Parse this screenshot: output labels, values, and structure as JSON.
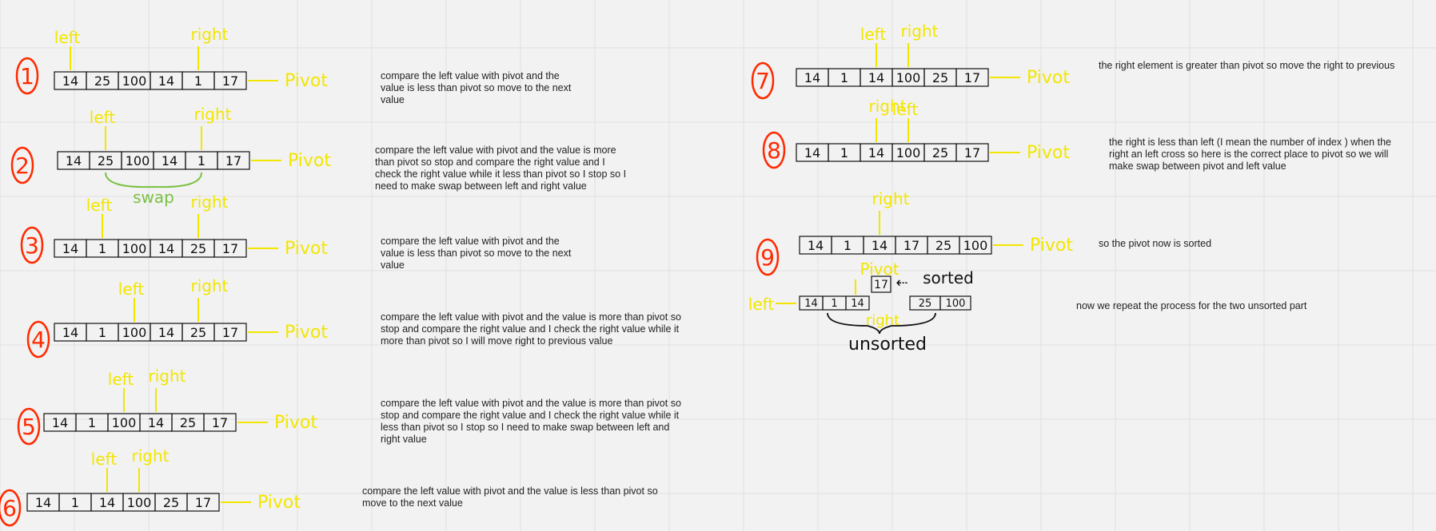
{
  "colors": {
    "marker": "#f2e600",
    "step": "#ff2a00",
    "swap": "#7ac143",
    "ink": "#111111",
    "grid": "#e0e0e0",
    "background": "#f2f2f2"
  },
  "labels": {
    "left": "left",
    "right": "right",
    "pivot": "Pivot",
    "swap": "swap",
    "sorted": "sorted",
    "unsorted": "unsorted"
  },
  "steps": [
    {
      "n": "1",
      "cells": [
        "14",
        "25",
        "100",
        "14",
        "1",
        "17"
      ],
      "left_at": 0,
      "right_at": 4,
      "note": "compare the left value with pivot and the\nvalue is less than pivot so move to the next\nvalue"
    },
    {
      "n": "2",
      "cells": [
        "14",
        "25",
        "100",
        "14",
        "1",
        "17"
      ],
      "left_at": 1,
      "right_at": 4,
      "swap": true,
      "note": "compare the left value with pivot and the value is more\nthan pivot so stop and compare the right value and I\ncheck the right value while it less than pivot so I stop so  I\nneed to make swap between left and right value"
    },
    {
      "n": "3",
      "cells": [
        "14",
        "1",
        "100",
        "14",
        "25",
        "17"
      ],
      "left_at": 1,
      "right_at": 4,
      "note": "compare the left value with pivot and the\nvalue is less than pivot so move to the next\nvalue"
    },
    {
      "n": "4",
      "cells": [
        "14",
        "1",
        "100",
        "14",
        "25",
        "17"
      ],
      "left_at": 2,
      "right_at": 4,
      "note": "compare the left value with pivot and the value is more than pivot so\nstop and compare the right value and I check the right value while it\nmore than pivot so I will move right to previous value"
    },
    {
      "n": "5",
      "cells": [
        "14",
        "1",
        "100",
        "14",
        "25",
        "17"
      ],
      "left_at": 2,
      "right_at": 3,
      "note": "compare the left value with pivot and the value is more than pivot so\nstop and compare the right value and I check the right value while it\nless than pivot so I stop so  I need to make swap between left and\nright value"
    },
    {
      "n": "6",
      "cells": [
        "14",
        "1",
        "14",
        "100",
        "25",
        "17"
      ],
      "left_at": 2,
      "right_at": 3,
      "note": "compare the left value with pivot and the value is less than pivot so\nmove to the next value"
    },
    {
      "n": "7",
      "cells": [
        "14",
        "1",
        "14",
        "100",
        "25",
        "17"
      ],
      "left_at": 2,
      "right_at": 3,
      "note": "the right element is greater than pivot so move the right to previous"
    },
    {
      "n": "8",
      "cells": [
        "14",
        "1",
        "14",
        "100",
        "25",
        "17"
      ],
      "left_at": 3,
      "right_at": 2,
      "note": "the right is less than left (I mean the number of index ) when the\nright an left cross so here is the correct place to pivot so we will\nmake swap between pivot and left value"
    },
    {
      "n": "9",
      "cells": [
        "14",
        "1",
        "14",
        "17",
        "25",
        "100"
      ],
      "left_at": 5,
      "right_at": 2,
      "note": "so the pivot now is sorted"
    }
  ],
  "split": {
    "pivot_value": "17",
    "left_part": [
      "14",
      "1",
      "14"
    ],
    "right_part": [
      "25",
      "100"
    ],
    "note": "now we repeat the process for the two unsorted part"
  }
}
